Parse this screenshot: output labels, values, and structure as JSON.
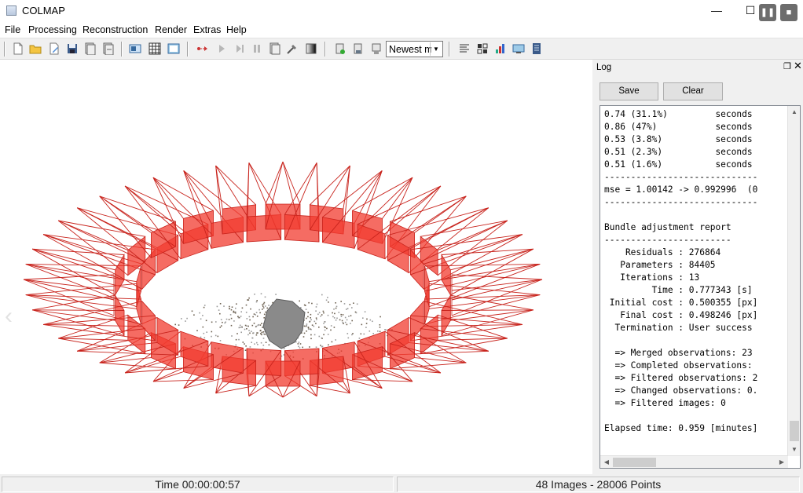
{
  "window": {
    "title": "COLMAP"
  },
  "window_controls": {
    "minimize": "—",
    "maximize": "☐",
    "close": "✕",
    "pause": "❚❚",
    "stop": "■"
  },
  "menu": [
    "File",
    "Processing",
    "Reconstruction",
    "Render",
    "Extras",
    "Help"
  ],
  "toolbar": {
    "icons": [
      "new-project-icon",
      "open-project-icon",
      "edit-project-icon",
      "save-project-icon",
      "import-model-icon",
      "export-model-icon",
      "feature-extraction-icon",
      "feature-matching-icon",
      "database-management-icon",
      "start-reconstruction-icon",
      "step-reconstruction-icon",
      "pause-reconstruction-icon",
      "reset-reconstruction-icon",
      "bundle-adjustment-icon",
      "dense-reconstruction-icon",
      "colormap-icon",
      "render-options-icon",
      "reconstruction-stats-icon",
      "match-matrix-icon",
      "log-icon",
      "grab-image-icon",
      "grab-movie-icon",
      "undistort-icon",
      "cluster-icon"
    ],
    "model_select": {
      "value": "Newest mo",
      "options": [
        "Newest model"
      ]
    }
  },
  "accent": {
    "camera": "#c8231c",
    "camera_fill": "#f23b2f",
    "points": "#8a8a8a"
  },
  "viewport": {
    "nav_left": "‹",
    "nav_right": "›"
  },
  "log": {
    "title": "Log",
    "float_icon": "❐",
    "close_icon": "✕",
    "save_label": "Save",
    "clear_label": "Clear",
    "lines": [
      "0.74 (31.1%)         seconds",
      "0.86 (47%)           seconds",
      "0.53 (3.8%)          seconds",
      "0.51 (2.3%)          seconds",
      "0.51 (1.6%)          seconds",
      "-----------------------------",
      "mse = 1.00142 -> 0.992996  (0",
      "-----------------------------",
      "",
      "Bundle adjustment report",
      "------------------------",
      "    Residuals : 276864",
      "   Parameters : 84405",
      "   Iterations : 13",
      "         Time : 0.777343 [s]",
      " Initial cost : 0.500355 [px]",
      "   Final cost : 0.498246 [px]",
      "  Termination : User success",
      "",
      "  => Merged observations: 23",
      "  => Completed observations:",
      "  => Filtered observations: 2",
      "  => Changed observations: 0.",
      "  => Filtered images: 0",
      "",
      "Elapsed time: 0.959 [minutes]"
    ]
  },
  "status": {
    "time": "Time 00:00:00:57",
    "summary": "48 Images - 28006 Points"
  }
}
